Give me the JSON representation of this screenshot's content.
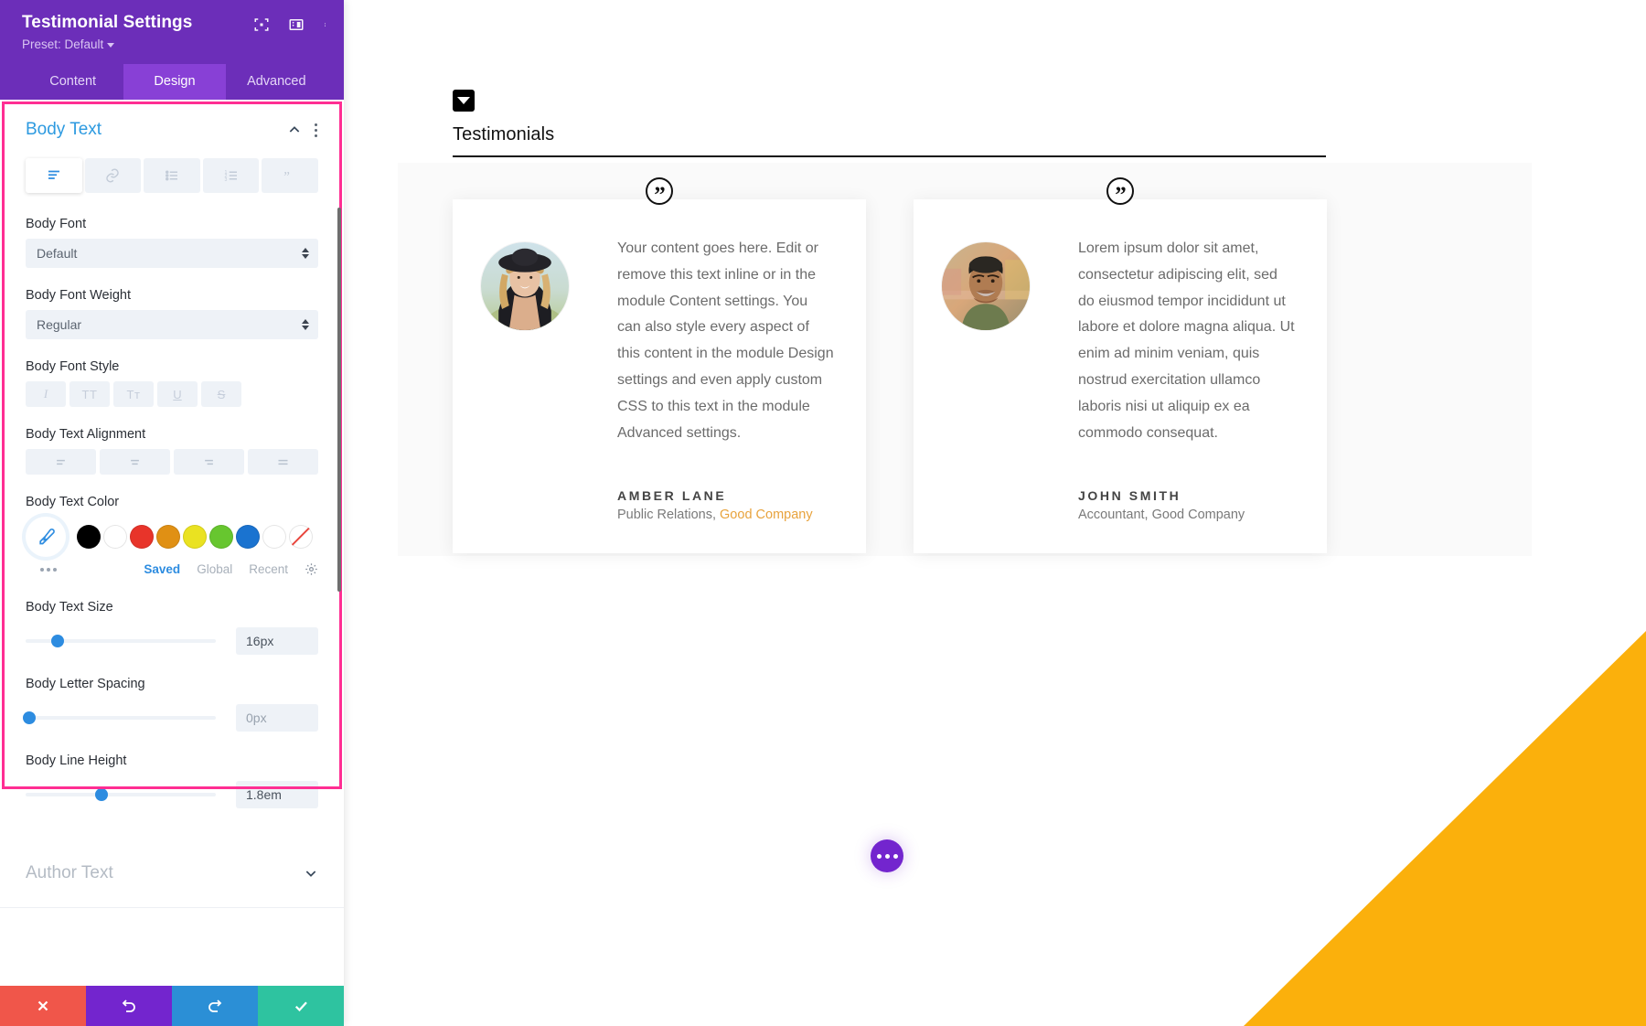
{
  "panel": {
    "title": "Testimonial Settings",
    "preset": "Preset: Default",
    "icons": {
      "focus": "focus-target-icon",
      "layout": "panel-layout-icon",
      "more": "kebab-menu-icon"
    },
    "tabs": [
      {
        "label": "Content",
        "active": false
      },
      {
        "label": "Design",
        "active": true
      },
      {
        "label": "Advanced",
        "active": false
      }
    ],
    "body_text_group": {
      "title": "Body Text",
      "toolbar": [
        {
          "name": "paragraph-style-icon",
          "active": true
        },
        {
          "name": "link-style-icon",
          "active": false
        },
        {
          "name": "unordered-list-icon",
          "active": false
        },
        {
          "name": "ordered-list-icon",
          "active": false
        },
        {
          "name": "blockquote-icon",
          "active": false
        }
      ],
      "body_font": {
        "label": "Body Font",
        "value": "Default"
      },
      "body_font_weight": {
        "label": "Body Font Weight",
        "value": "Regular"
      },
      "body_font_style": {
        "label": "Body Font Style",
        "buttons": [
          {
            "glyph": "I",
            "name": "italic-button"
          },
          {
            "glyph": "TT",
            "name": "uppercase-button"
          },
          {
            "glyph": "Tт",
            "name": "capitalize-button"
          },
          {
            "glyph": "U",
            "name": "underline-button"
          },
          {
            "glyph": "S",
            "name": "strikethrough-button"
          }
        ]
      },
      "body_text_alignment": {
        "label": "Body Text Alignment",
        "options": [
          "left",
          "center",
          "right",
          "justify"
        ]
      },
      "body_text_color": {
        "label": "Body Text Color",
        "swatches": [
          "#000000",
          "#ffffff",
          "#e8342a",
          "#e09014",
          "#eae221",
          "#67c62f",
          "#1a73d0",
          "#ffffff",
          "none"
        ],
        "tabs": [
          {
            "label": "Saved",
            "active": true
          },
          {
            "label": "Global",
            "active": false
          },
          {
            "label": "Recent",
            "active": false
          }
        ]
      },
      "body_text_size": {
        "label": "Body Text Size",
        "value": "16px",
        "knob_pct": 17
      },
      "body_letter_spacing": {
        "label": "Body Letter Spacing",
        "value": "0px",
        "placeholder": "0px",
        "knob_pct": 2
      },
      "body_line_height": {
        "label": "Body Line Height",
        "value": "1.8em",
        "knob_pct": 40
      }
    },
    "author_text_group": {
      "title": "Author Text"
    },
    "footer": [
      {
        "name": "cancel-button",
        "icon": "close-icon"
      },
      {
        "name": "undo-button",
        "icon": "undo-arrow-icon"
      },
      {
        "name": "redo-button",
        "icon": "redo-arrow-icon"
      },
      {
        "name": "save-button",
        "icon": "check-icon"
      }
    ]
  },
  "preview": {
    "section": {
      "title": "Testimonials",
      "toggle_icon": "collapse-caret-icon"
    },
    "cards": [
      {
        "quote_icon": "quote-mark-icon",
        "avatar": "woman-in-hat-photo",
        "text": "Your content goes here. Edit or remove this text inline or in the module Content settings. You can also style every aspect of this content in the module Design settings and even apply custom CSS to this text in the module Advanced settings.",
        "name": "AMBER LANE",
        "role_prefix": "Public Relations, ",
        "role_company": "Good Company",
        "company_color": "#e8a33d"
      },
      {
        "quote_icon": "quote-mark-icon",
        "avatar": "smiling-man-photo",
        "text": "Lorem ipsum dolor sit amet, consectetur adipiscing elit, sed do eiusmod tempor incididunt ut labore et dolore magna aliqua. Ut enim ad minim veniam, quis nostrud exercitation ullamco laboris nisi ut aliquip ex ea commodo consequat.",
        "name": "JOHN SMITH",
        "role_prefix": "Accountant, Good Company",
        "role_company": "",
        "company_color": "#7a7a7a"
      }
    ],
    "fab": {
      "name": "page-settings-fab",
      "icon": "ellipsis-icon"
    },
    "corner_accent_color": "#fbb00c"
  }
}
